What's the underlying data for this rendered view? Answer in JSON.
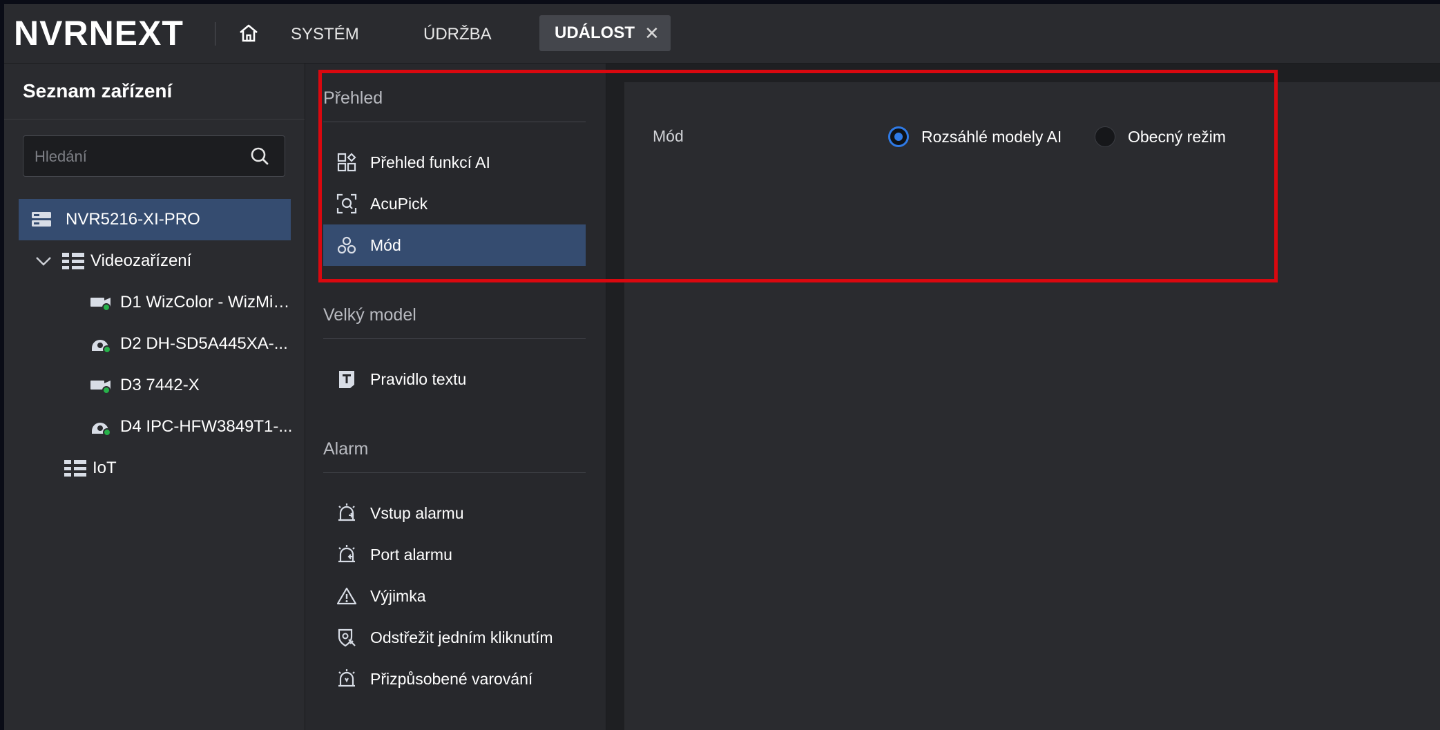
{
  "header": {
    "logo_text": "NVRNEXT",
    "nav": [
      "SYSTÉM",
      "ÚDRŽBA"
    ],
    "active_tab": "UDÁLOST",
    "active_tab_close": "✕"
  },
  "device_panel": {
    "title": "Seznam zařízení",
    "search_placeholder": "Hledání",
    "root": "NVR5216-XI-PRO",
    "group_video": "Videozařízení",
    "devices": [
      "D1 WizColor - WizMind...",
      "D2 DH-SD5A445XA-...",
      "D3 7442-X",
      "D4 IPC-HFW3849T1-..."
    ],
    "group_iot": "IoT"
  },
  "menu": {
    "section_overview": "Přehled",
    "overview_items": [
      "Přehled funkcí AI",
      "AcuPick",
      "Mód"
    ],
    "section_large_model": "Velký model",
    "large_model_items": [
      "Pravidlo textu"
    ],
    "section_alarm": "Alarm",
    "alarm_items": [
      "Vstup alarmu",
      "Port alarmu",
      "Výjimka",
      "Odstřežit jedním kliknutím",
      "Přizpůsobené varování"
    ]
  },
  "content": {
    "mode_label": "Mód",
    "options": [
      "Rozsáhlé modely AI",
      "Obecný režim"
    ],
    "selected_option": "Rozsáhlé modely AI"
  },
  "colors": {
    "accent": "#2f7ae5",
    "selection": "#354c70",
    "highlight": "#d9080f"
  }
}
